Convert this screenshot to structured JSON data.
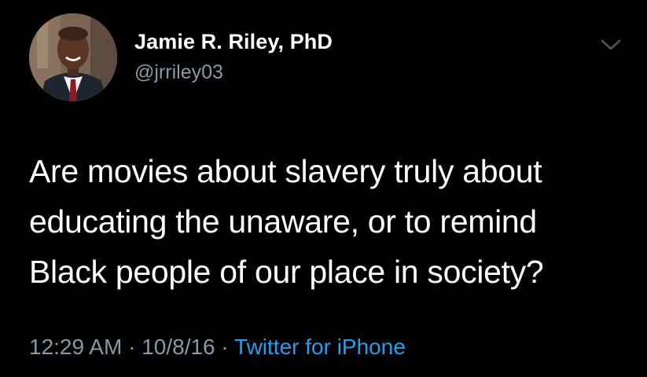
{
  "user": {
    "display_name": "Jamie R. Riley, PhD",
    "handle": "@jrriley03"
  },
  "tweet": {
    "text": "Are movies about slavery truly about\neducating the unaware, or to remind\nBlack people of our place in society?",
    "time": "12:29 AM",
    "date": "10/8/16",
    "separator": "·",
    "source": "Twitter for iPhone"
  },
  "icons": {
    "menu": "chevron-down-icon"
  },
  "colors": {
    "background": "#000000",
    "text": "#ffffff",
    "muted": "#8899a6",
    "link": "#1da1f2"
  }
}
